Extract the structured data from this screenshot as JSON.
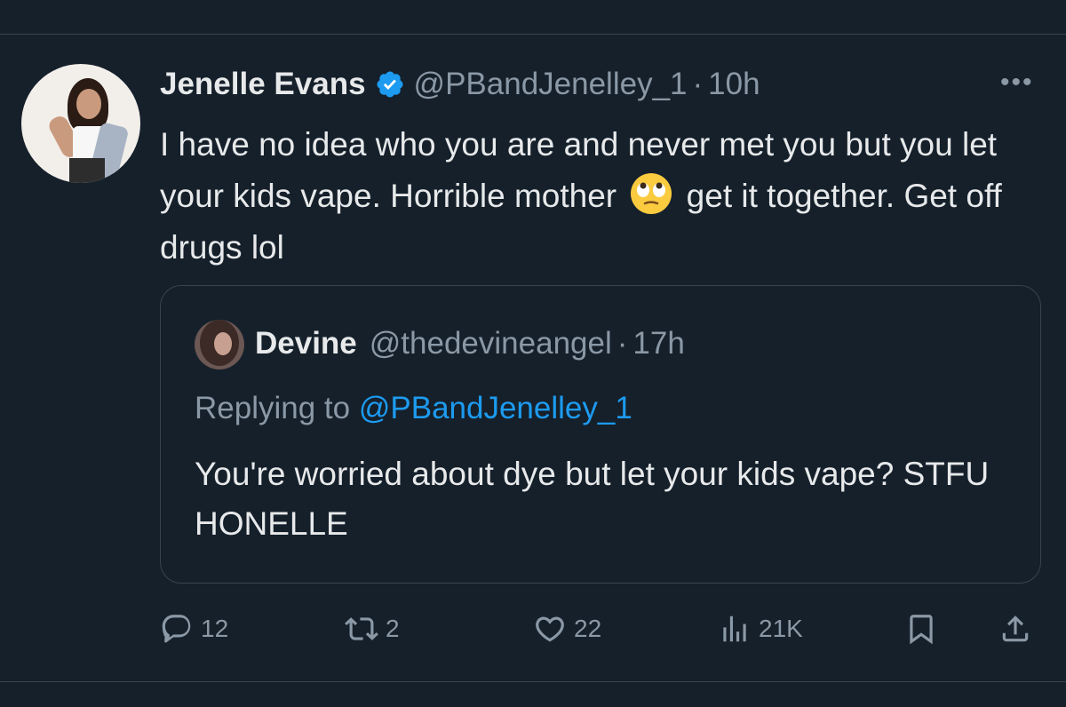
{
  "tweet": {
    "author_name": "Jenelle Evans",
    "handle": "@PBandJenelley_1",
    "dot": "·",
    "time": "10h",
    "more": "•••",
    "text_part1": "I have no idea who you are and never met you but you let your kids vape. Horrible mother",
    "emoji": "face-with-rolling-eyes-emoji",
    "text_part2": "get it together. Get off drugs lol"
  },
  "quote": {
    "author_name": "Devine",
    "handle": "@thedevineangel",
    "dot": "·",
    "time": "17h",
    "replying_prefix": "Replying to",
    "replying_handle": "@PBandJenelley_1",
    "text": "You're worried about dye but let your kids vape? STFU HONELLE"
  },
  "actions": {
    "reply_count": "12",
    "retweet_count": "2",
    "like_count": "22",
    "views_count": "21K"
  },
  "colors": {
    "background": "#15202b",
    "text_primary": "#e7e9ea",
    "text_secondary": "#8b98a5",
    "accent": "#1d9bf0",
    "border": "#38444d"
  }
}
